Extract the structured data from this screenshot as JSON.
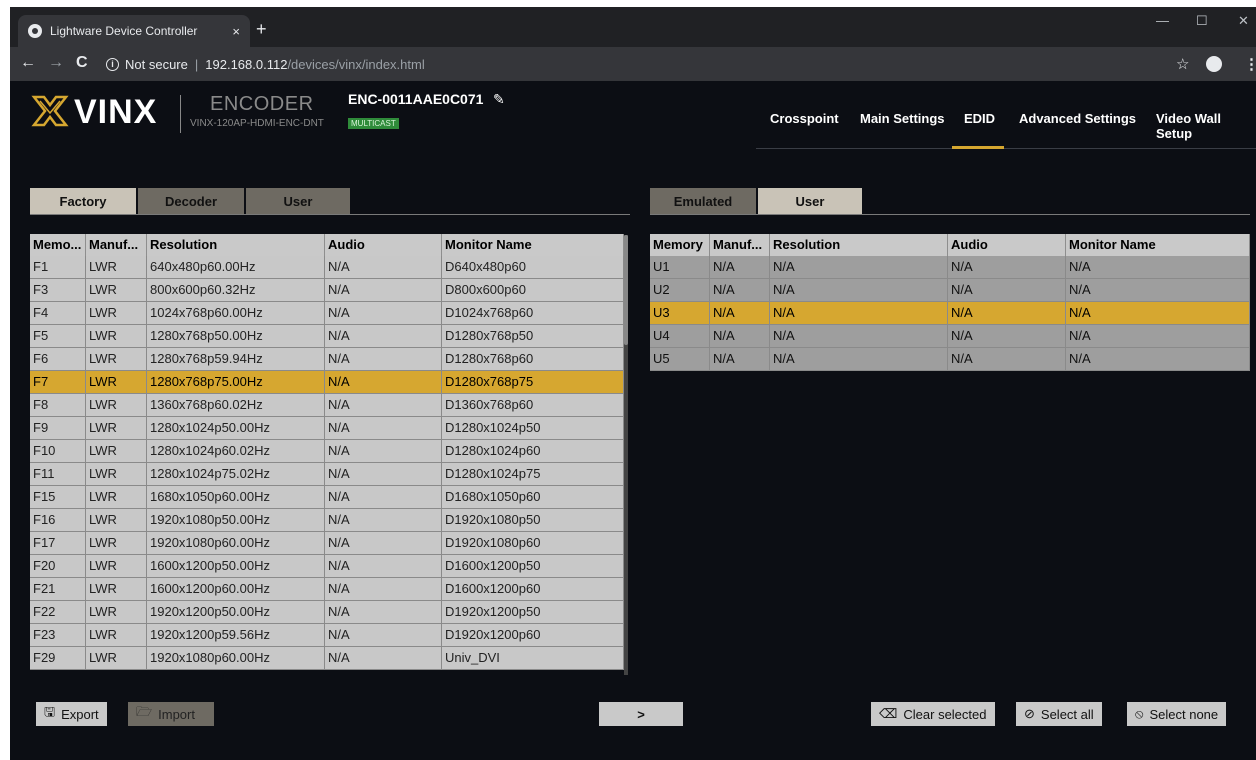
{
  "browser": {
    "tab_title": "Lightware Device Controller",
    "tab_close": "×",
    "new_tab": "+",
    "url_secure_label": "Not secure",
    "url_host": "192.168.0.112",
    "url_path": "/devices/vinx/index.html"
  },
  "header": {
    "brand": "VINX",
    "device_type": "ENCODER",
    "model": "VINX-120AP-HDMI-ENC-DNT",
    "device_name": "ENC-0011AAE0C071",
    "badge": "MULTICAST",
    "menu": [
      "Crosspoint",
      "Main Settings",
      "EDID",
      "Advanced Settings",
      "Video Wall Setup"
    ],
    "active_menu": "EDID"
  },
  "left_tabs": [
    "Factory",
    "Decoder",
    "User"
  ],
  "right_tabs": [
    "Emulated",
    "User"
  ],
  "left_table": {
    "columns": [
      "Memo...",
      "Manuf...",
      "Resolution",
      "Audio",
      "Monitor Name"
    ],
    "rows": [
      [
        "F1",
        "LWR",
        "640x480p60.00Hz",
        "N/A",
        "D640x480p60"
      ],
      [
        "F3",
        "LWR",
        "800x600p60.32Hz",
        "N/A",
        "D800x600p60"
      ],
      [
        "F4",
        "LWR",
        "1024x768p60.00Hz",
        "N/A",
        "D1024x768p60"
      ],
      [
        "F5",
        "LWR",
        "1280x768p50.00Hz",
        "N/A",
        "D1280x768p50"
      ],
      [
        "F6",
        "LWR",
        "1280x768p59.94Hz",
        "N/A",
        "D1280x768p60"
      ],
      [
        "F7",
        "LWR",
        "1280x768p75.00Hz",
        "N/A",
        "D1280x768p75"
      ],
      [
        "F8",
        "LWR",
        "1360x768p60.02Hz",
        "N/A",
        "D1360x768p60"
      ],
      [
        "F9",
        "LWR",
        "1280x1024p50.00Hz",
        "N/A",
        "D1280x1024p50"
      ],
      [
        "F10",
        "LWR",
        "1280x1024p60.02Hz",
        "N/A",
        "D1280x1024p60"
      ],
      [
        "F11",
        "LWR",
        "1280x1024p75.02Hz",
        "N/A",
        "D1280x1024p75"
      ],
      [
        "F15",
        "LWR",
        "1680x1050p60.00Hz",
        "N/A",
        "D1680x1050p60"
      ],
      [
        "F16",
        "LWR",
        "1920x1080p50.00Hz",
        "N/A",
        "D1920x1080p50"
      ],
      [
        "F17",
        "LWR",
        "1920x1080p60.00Hz",
        "N/A",
        "D1920x1080p60"
      ],
      [
        "F20",
        "LWR",
        "1600x1200p50.00Hz",
        "N/A",
        "D1600x1200p50"
      ],
      [
        "F21",
        "LWR",
        "1600x1200p60.00Hz",
        "N/A",
        "D1600x1200p60"
      ],
      [
        "F22",
        "LWR",
        "1920x1200p50.00Hz",
        "N/A",
        "D1920x1200p50"
      ],
      [
        "F23",
        "LWR",
        "1920x1200p59.56Hz",
        "N/A",
        "D1920x1200p60"
      ],
      [
        "F29",
        "LWR",
        "1920x1080p60.00Hz",
        "N/A",
        "Univ_DVI"
      ]
    ],
    "selected": "F7"
  },
  "right_table": {
    "columns": [
      "Memory",
      "Manuf...",
      "Resolution",
      "Audio",
      "Monitor Name"
    ],
    "rows": [
      [
        "U1",
        "N/A",
        "N/A",
        "N/A",
        "N/A"
      ],
      [
        "U2",
        "N/A",
        "N/A",
        "N/A",
        "N/A"
      ],
      [
        "U3",
        "N/A",
        "N/A",
        "N/A",
        "N/A"
      ],
      [
        "U4",
        "N/A",
        "N/A",
        "N/A",
        "N/A"
      ],
      [
        "U5",
        "N/A",
        "N/A",
        "N/A",
        "N/A"
      ]
    ],
    "selected": "U3"
  },
  "buttons": {
    "export": "Export",
    "import": "Import",
    "transfer": ">",
    "clear_selected": "Clear selected",
    "select_all": "Select all",
    "select_none": "Select none"
  },
  "colors": {
    "accent": "#d6a730",
    "background": "#0c0e14",
    "badge": "#2f8b3a"
  }
}
